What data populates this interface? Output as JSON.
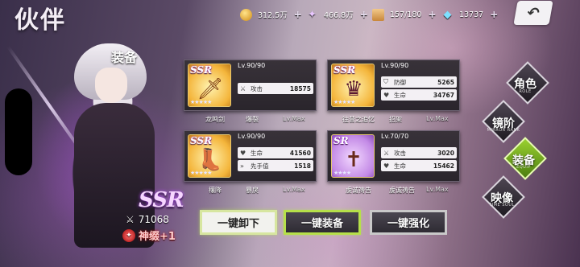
{
  "header": {
    "title": "伙伴",
    "resources": [
      {
        "icon": "gold-coin-icon",
        "value": "312.5万"
      },
      {
        "icon": "crystal-icon",
        "value": "466.8万"
      },
      {
        "icon": "stamina-box-icon",
        "value": "157/180"
      },
      {
        "icon": "diamond-icon",
        "value": "13737"
      }
    ],
    "plus": "+",
    "back_icon": "↶"
  },
  "character": {
    "section_label": "装备",
    "rarity": "SSR",
    "power": "71068",
    "divine_level": "神缀+1"
  },
  "equipment": [
    {
      "rarity": "SSR",
      "icon": "sword-icon",
      "level": "Lv.90/90",
      "stats": [
        {
          "icon": "attack-icon",
          "name": "攻击",
          "value": "18575"
        }
      ],
      "name": "龙鸣剑",
      "trait": "爆裂",
      "max": "Lv.Max"
    },
    {
      "rarity": "SSR",
      "icon": "portrait-icon",
      "level": "Lv.90/90",
      "stats": [
        {
          "icon": "defense-icon",
          "name": "防御",
          "value": "5265"
        },
        {
          "icon": "health-icon",
          "name": "生命",
          "value": "34767"
        }
      ],
      "name": "往昔之追忆",
      "trait": "招架",
      "max": "Lv.Max"
    },
    {
      "rarity": "SSR",
      "icon": "boot-icon",
      "level": "Lv.90/90",
      "stats": [
        {
          "icon": "health-icon",
          "name": "生命",
          "value": "41560"
        },
        {
          "icon": "speed-icon",
          "name": "先手值",
          "value": "1518"
        }
      ],
      "name": "穰降",
      "trait": "暴戾",
      "max": "Lv.Max"
    },
    {
      "rarity": "SR",
      "icon": "rosary-icon",
      "level": "Lv.70/70",
      "stats": [
        {
          "icon": "attack-icon",
          "name": "攻击",
          "value": "3020"
        },
        {
          "icon": "health-icon",
          "name": "生命",
          "value": "15462"
        }
      ],
      "name": "虔诚祷告",
      "trait": "虔诚祷告",
      "max": "Lv.Max"
    }
  ],
  "actions": {
    "unequip": "一键卸下",
    "equip": "一键装备",
    "enhance": "一键强化"
  },
  "side_menu": [
    {
      "label": "角色",
      "sub": "ROLE"
    },
    {
      "label": "镜阶",
      "sub": "MIRROR RANK"
    },
    {
      "label": "装备",
      "sub": "EQUIP"
    },
    {
      "label": "映像",
      "sub": "TIME SOUL"
    }
  ]
}
